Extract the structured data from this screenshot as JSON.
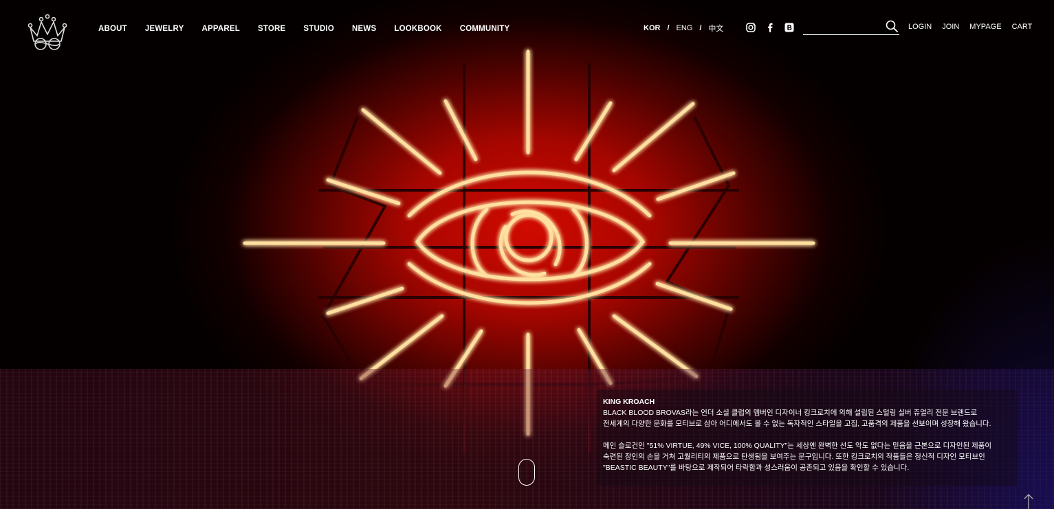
{
  "header": {
    "logo_icon": "crown-logo-icon",
    "nav": [
      "ABOUT",
      "JEWELRY",
      "APPAREL",
      "STORE",
      "STUDIO",
      "NEWS",
      "LOOKBOOK",
      "COMMUNITY"
    ],
    "languages": {
      "kor": "KOR",
      "eng": "ENG",
      "chn": "中文",
      "separator": "/"
    },
    "social_icons": [
      "instagram-icon",
      "facebook-icon",
      "blog-icon"
    ],
    "search": {
      "value": "",
      "placeholder": ""
    },
    "user_menu": {
      "login": "LOGIN",
      "join": "JOIN",
      "mypage": "MYPAGE",
      "cart": "CART"
    }
  },
  "hero": {
    "image": "neon-eye-sign"
  },
  "info": {
    "brand": "KING KROACH",
    "line1": "BLACK BLOOD BROVAS라는 언더 소셜 클럽의 멤버인 디자이너 킹크로치에 의해 설립된 스털링 실버 쥬얼리 전문 브랜드로",
    "line2": "전세계의 다양한 문화를 모티브로 삼아 어디에서도 볼 수 없는 독자적인 스타일을 고집, 고품격의 제품을 선보이며 성장해 왔습니다.",
    "line3": "메인 슬로건인 \"51% VIRTUE, 49% VICE, 100% QUALITY\"는 세상엔 완벽한 선도 악도 없다는 믿음을 근본으로 디자인된 제품이",
    "line4": "숙련된 장인의 손을 거쳐 고퀄리티의 제품으로 탄생됨을 보여주는 문구입니다. 또한 킹크로치의 작품들은 정신적 디자인 모티브인",
    "line5": "\"BEASTIC BEAUTY\"를 바탕으로 제작되어 타락함과 성스러움이 공존되고 있음을 확인할 수 있습니다."
  },
  "colors": {
    "neon": "#ffd27a",
    "neon_glow": "#ff5a1a",
    "background_red": "#d10a00"
  }
}
